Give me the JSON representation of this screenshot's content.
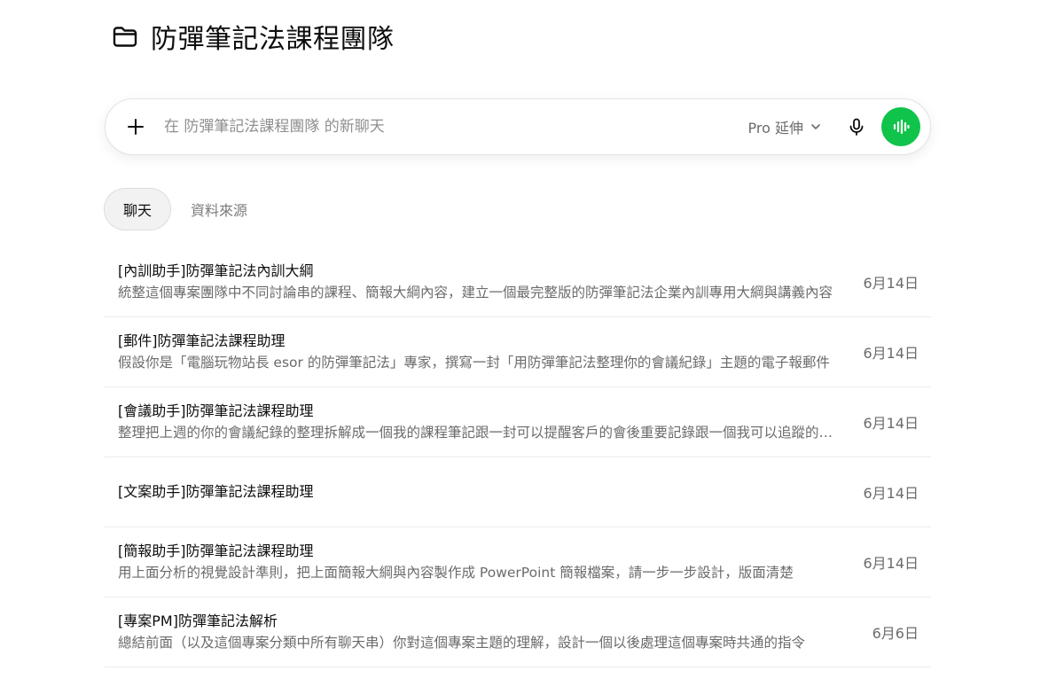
{
  "project": {
    "title": "防彈筆記法課程團隊",
    "icon": "folder-icon"
  },
  "composer": {
    "placeholder": "在 防彈筆記法課程團隊 的新聊天",
    "model_label": "Pro 延伸",
    "voice_color": "#10c34a"
  },
  "tabs": [
    {
      "label": "聊天",
      "active": true
    },
    {
      "label": "資料來源",
      "active": false
    }
  ],
  "chats": [
    {
      "title": "[內訓助手]防彈筆記法內訓大綱",
      "preview": "統整這個專案團隊中不同討論串的課程、簡報大綱內容，建立一個最完整版的防彈筆記法企業內訓專用大綱與講義內容",
      "date": "6月14日"
    },
    {
      "title": "[郵件]防彈筆記法課程助理",
      "preview": "假設你是「電腦玩物站長 esor 的防彈筆記法」專家，撰寫一封「用防彈筆記法整理你的會議紀錄」主題的電子報郵件",
      "date": "6月14日"
    },
    {
      "title": "[會議助手]防彈筆記法課程助理",
      "preview": "整理把上週的你的會議紀錄的整理拆解成一個我的課程筆記跟一封可以提醒客戶的會後重要記錄跟一個我可以追蹤的任務",
      "date": "6月14日"
    },
    {
      "title": "[文案助手]防彈筆記法課程助理",
      "preview": "",
      "date": "6月14日"
    },
    {
      "title": "[簡報助手]防彈筆記法課程助理",
      "preview": "用上面分析的視覺設計準則，把上面簡報大綱與內容製作成 PowerPoint 簡報檔案，請一步一步設計，版面清楚",
      "date": "6月14日"
    },
    {
      "title": "[專案PM]防彈筆記法解析",
      "preview": "總結前面（以及這個專案分類中所有聊天串）你對這個專案主題的理解，設計一個以後處理這個專案時共通的指令",
      "date": "6月6日"
    }
  ]
}
